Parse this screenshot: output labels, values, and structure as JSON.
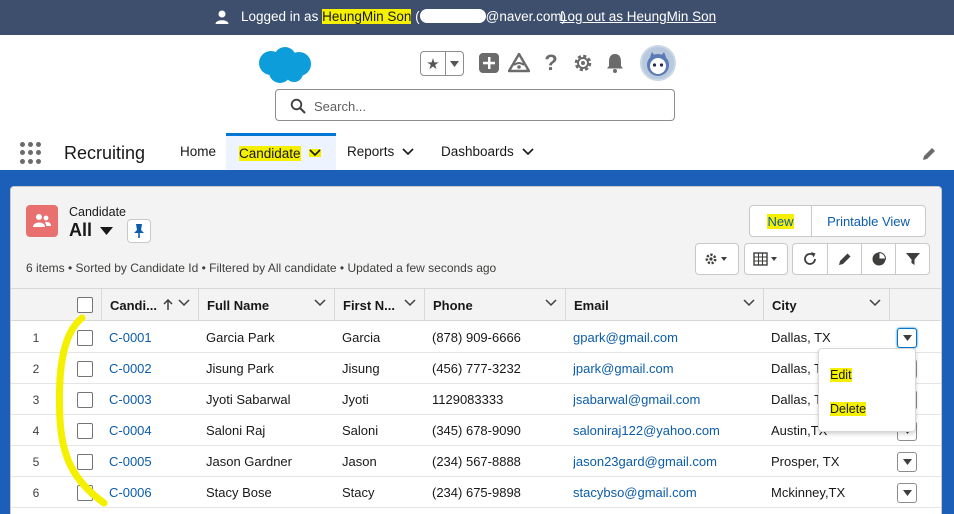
{
  "banner": {
    "logged_prefix": "Logged in as ",
    "user_name": "HeungMin Son",
    "email_open": " (",
    "email_suffix": "@naver.com)",
    "logout_label": "Log out as HeungMin Son"
  },
  "search": {
    "placeholder": "Search..."
  },
  "nav": {
    "app_name": "Recruiting",
    "items": [
      {
        "label": "Home"
      },
      {
        "label": "Candidate"
      },
      {
        "label": "Reports"
      },
      {
        "label": "Dashboards"
      }
    ]
  },
  "list_header": {
    "object_label": "Candidate",
    "view_name": "All",
    "summary": "6 items • Sorted by Candidate Id • Filtered by All candidate • Updated a few seconds ago",
    "new_label": "New",
    "printable_label": "Printable View"
  },
  "table": {
    "columns": [
      {
        "label": "Candi..."
      },
      {
        "label": "Full Name"
      },
      {
        "label": "First N..."
      },
      {
        "label": "Phone"
      },
      {
        "label": "Email"
      },
      {
        "label": "City"
      }
    ],
    "rows": [
      {
        "num": "1",
        "id": "C-0001",
        "full_name": "Garcia Park",
        "first_name": "Garcia",
        "phone": "(878) 909-6666",
        "email": "gpark@gmail.com",
        "city": "Dallas, TX"
      },
      {
        "num": "2",
        "id": "C-0002",
        "full_name": "Jisung Park",
        "first_name": "Jisung",
        "phone": "(456) 777-3232",
        "email": "jpark@gmail.com",
        "city": "Dallas, TX"
      },
      {
        "num": "3",
        "id": "C-0003",
        "full_name": "Jyoti Sabarwal",
        "first_name": "Jyoti",
        "phone": "1129083333",
        "email": "jsabarwal@gmail.com",
        "city": "Dallas, TX"
      },
      {
        "num": "4",
        "id": "C-0004",
        "full_name": "Saloni Raj",
        "first_name": "Saloni",
        "phone": "(345) 678-9090",
        "email": "saloniraj122@yahoo.com",
        "city": "Austin,TX"
      },
      {
        "num": "5",
        "id": "C-0005",
        "full_name": "Jason Gardner",
        "first_name": "Jason",
        "phone": "(234) 567-8888",
        "email": "jason23gard@gmail.com",
        "city": "Prosper, TX"
      },
      {
        "num": "6",
        "id": "C-0006",
        "full_name": "Stacy Bose",
        "first_name": "Stacy",
        "phone": "(234) 675-9898",
        "email": "stacybso@gmail.com",
        "city": "Mckinney,TX"
      }
    ]
  },
  "row_menu": {
    "edit_label": "Edit",
    "delete_label": "Delete"
  },
  "colors": {
    "banner": "#3e4f6e",
    "brand_blue": "#1b5fb8",
    "link": "#0b5cab",
    "highlight": "#f4f000",
    "object_icon": "#e8706f"
  },
  "icons": [
    "user-icon",
    "salesforce-cloud-icon",
    "star-icon",
    "add-icon",
    "trailhead-icon",
    "help-icon",
    "gear-icon",
    "bell-icon",
    "search-icon",
    "app-launcher-icon",
    "chevron-down-icon",
    "edit-pencil-icon",
    "candidate-object-icon",
    "pin-icon",
    "list-settings-icon",
    "table-display-icon",
    "refresh-icon",
    "chart-icon",
    "filter-icon",
    "sort-arrow-up-icon"
  ]
}
